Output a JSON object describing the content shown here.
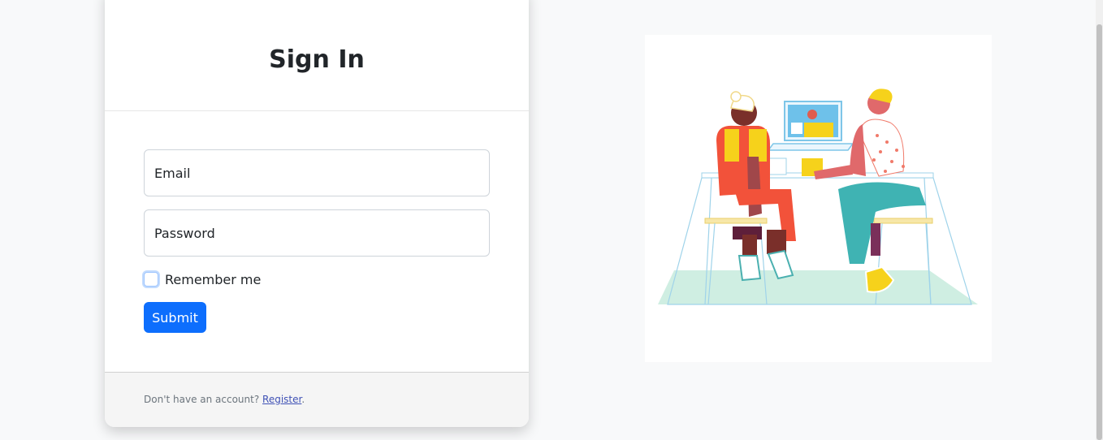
{
  "signin": {
    "title": "Sign In",
    "email_placeholder": "Email",
    "password_placeholder": "Password",
    "remember_label": "Remember me",
    "submit_label": "Submit",
    "footer_text": "Don't have an account?",
    "register_link": "Register",
    "footer_period": "."
  },
  "colors": {
    "primary": "#0d6efd",
    "background": "#f8f9fa"
  },
  "illustration": {
    "icon": "people-at-desk-illustration"
  }
}
